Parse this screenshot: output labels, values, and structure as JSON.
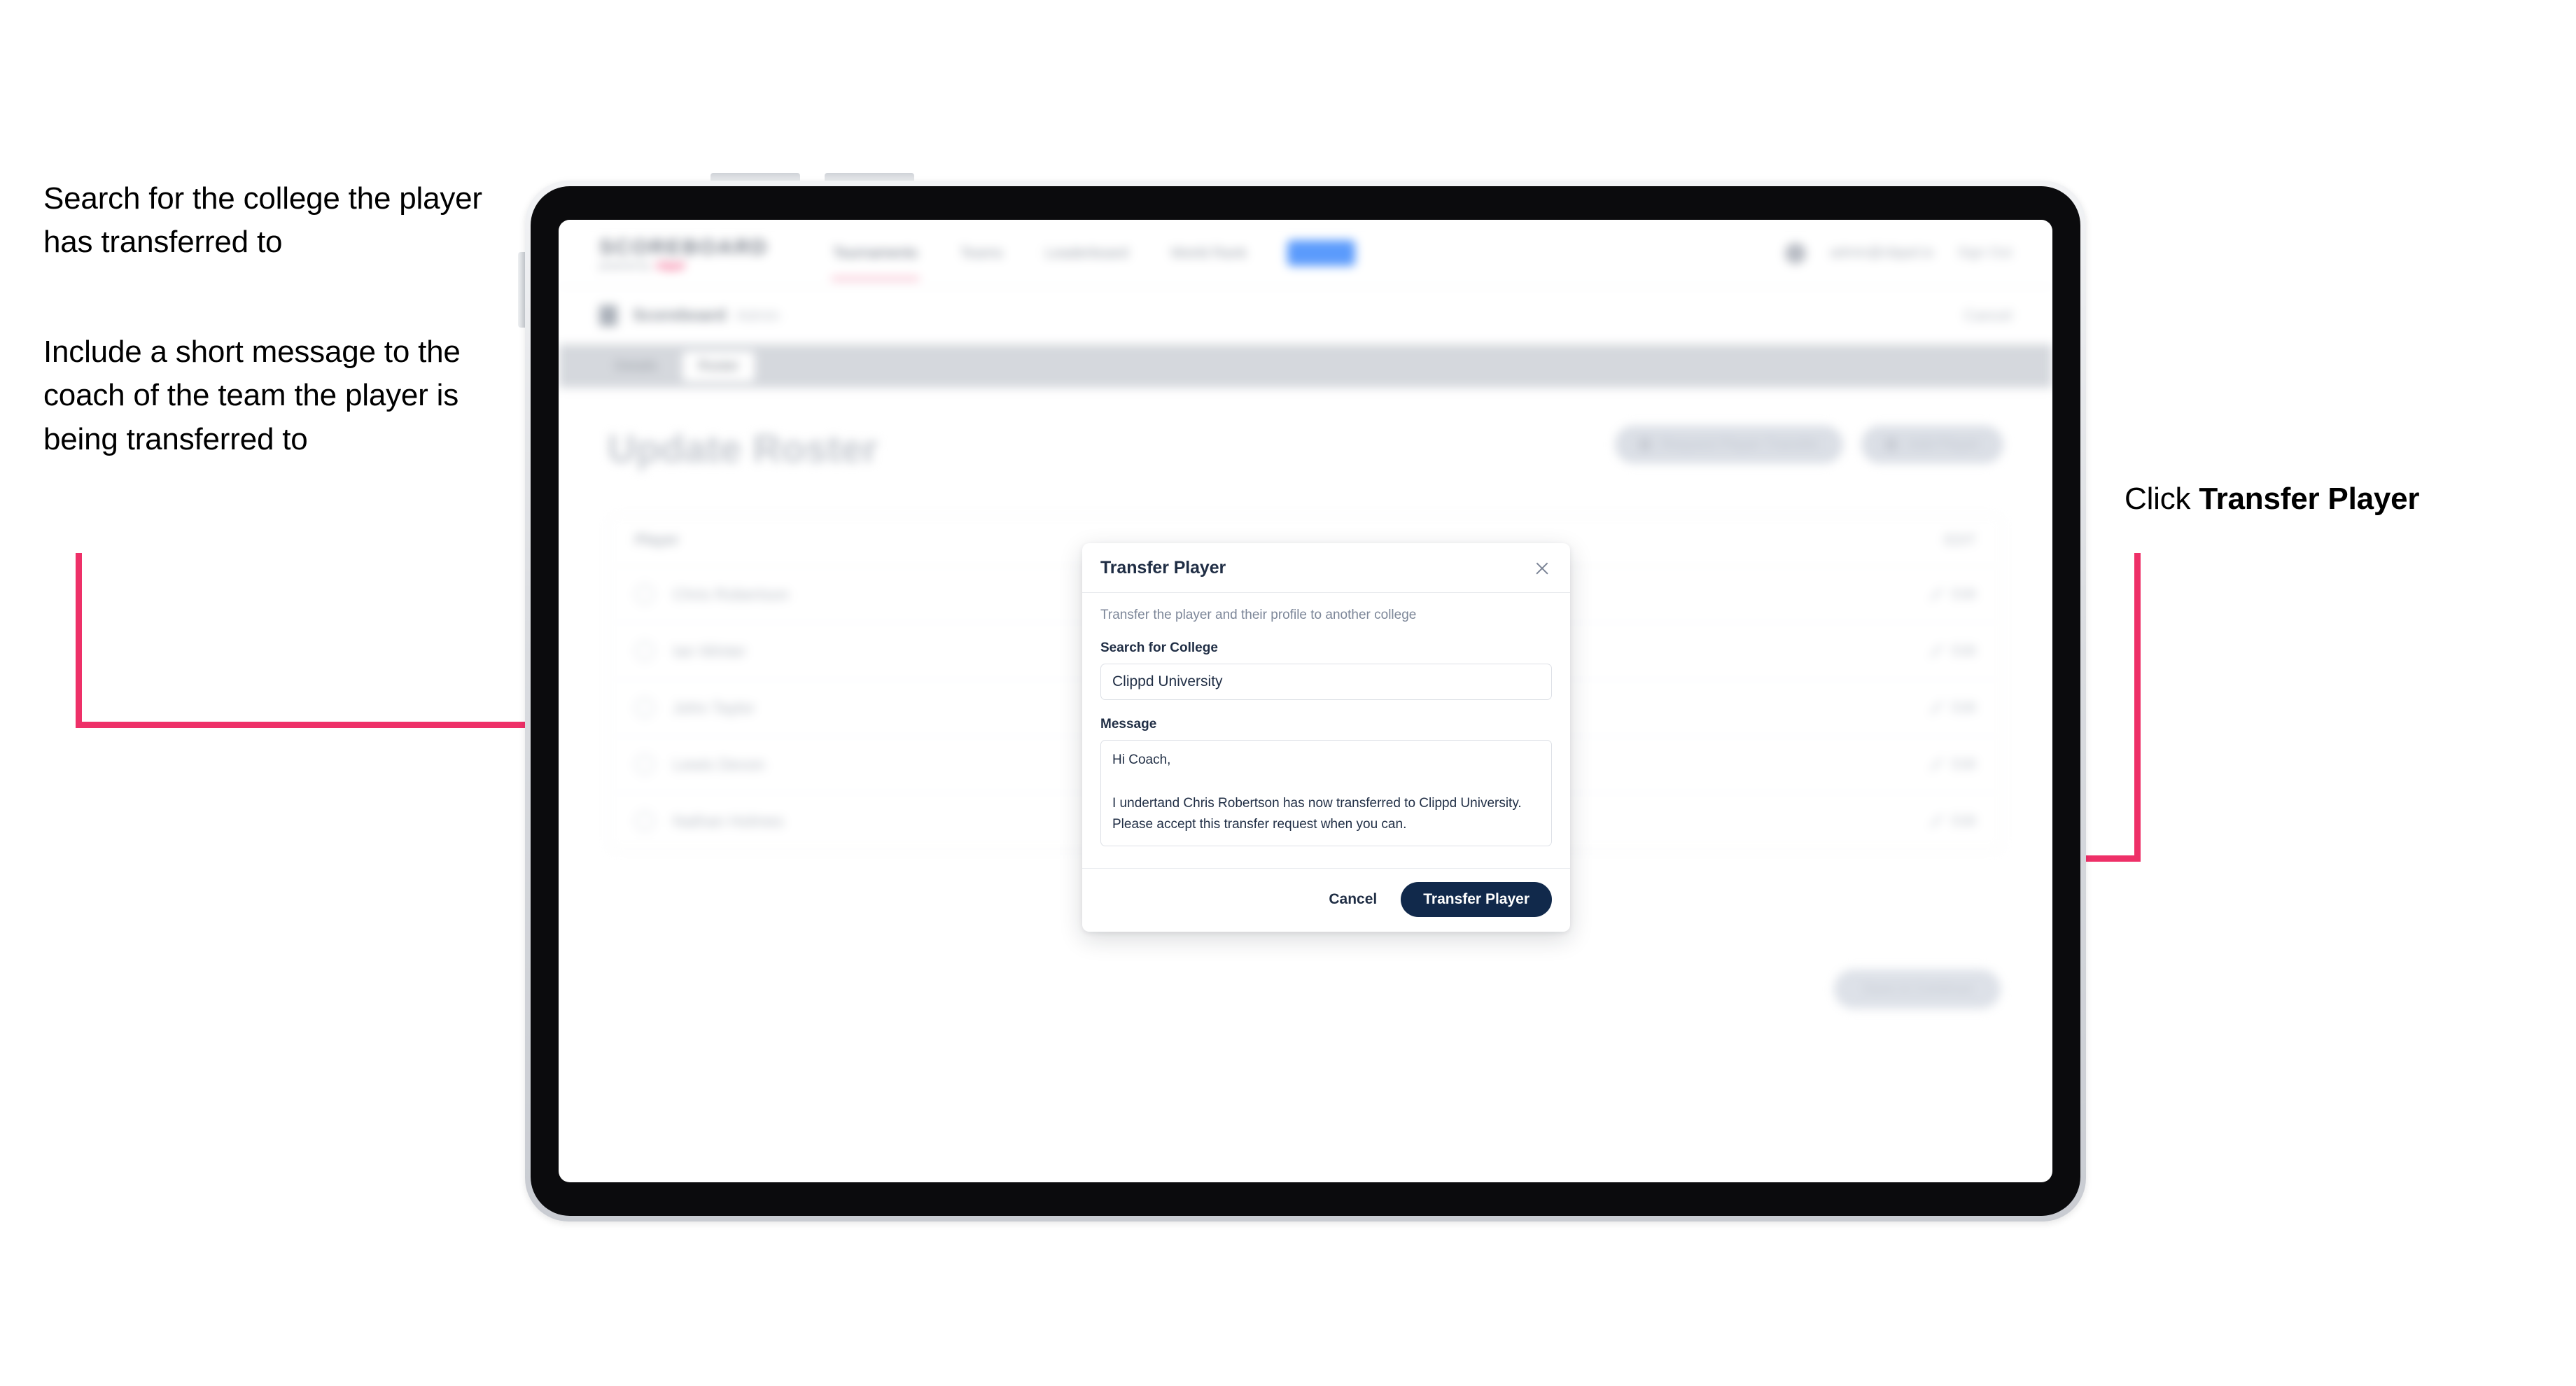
{
  "annotations": {
    "left_1": "Search for the college the player has transferred to",
    "left_2": "Include a short message to the coach of the team the player is being transferred to",
    "right_1_prefix": "Click ",
    "right_1_strong": "Transfer Player"
  },
  "app": {
    "navbar": {
      "brand_name": "SCOREBOARD",
      "brand_sub_prefix": "powered by",
      "brand_sub_mark": "clippd",
      "links": [
        {
          "label": "Tournaments",
          "active": true
        },
        {
          "label": "Teams",
          "active": false
        },
        {
          "label": "Leaderboard",
          "active": false
        },
        {
          "label": "World Rank",
          "active": false
        }
      ],
      "pill_label": "Admin",
      "user": "admin@clippd.io",
      "sign_out": "Sign Out"
    },
    "subbar": {
      "title": "Scoreboard",
      "subtitle": "Admin",
      "right_action": "Cancel"
    },
    "tabs": [
      {
        "label": "Details",
        "active": false
      },
      {
        "label": "Roster",
        "active": true
      }
    ],
    "page_title": "Update Roster",
    "page_actions": [
      {
        "label": "Request Player Transfer"
      },
      {
        "label": "Add Player"
      }
    ],
    "roster": {
      "header_label": "Player",
      "header_right": "EDIT",
      "rows": [
        {
          "name": "Chris Robertson",
          "edit": "Edit"
        },
        {
          "name": "Ian Winter",
          "edit": "Edit"
        },
        {
          "name": "John Taylor",
          "edit": "Edit"
        },
        {
          "name": "Lewis Devon",
          "edit": "Edit"
        },
        {
          "name": "Nathan Holmes",
          "edit": "Edit"
        }
      ]
    },
    "footer_button": "Save & Continue"
  },
  "modal": {
    "title": "Transfer Player",
    "description": "Transfer the player and their profile to another college",
    "college_label": "Search for College",
    "college_value": "Clippd University",
    "college_placeholder": "Search for College",
    "message_label": "Message",
    "message_value": "Hi Coach,\n\nI undertand Chris Robertson has now transferred to Clippd University. Please accept this transfer request when you can.",
    "message_placeholder": "Message",
    "cancel_label": "Cancel",
    "submit_label": "Transfer Player"
  },
  "colors": {
    "accent_pink": "#EE3068",
    "primary_navy": "#11294B"
  }
}
